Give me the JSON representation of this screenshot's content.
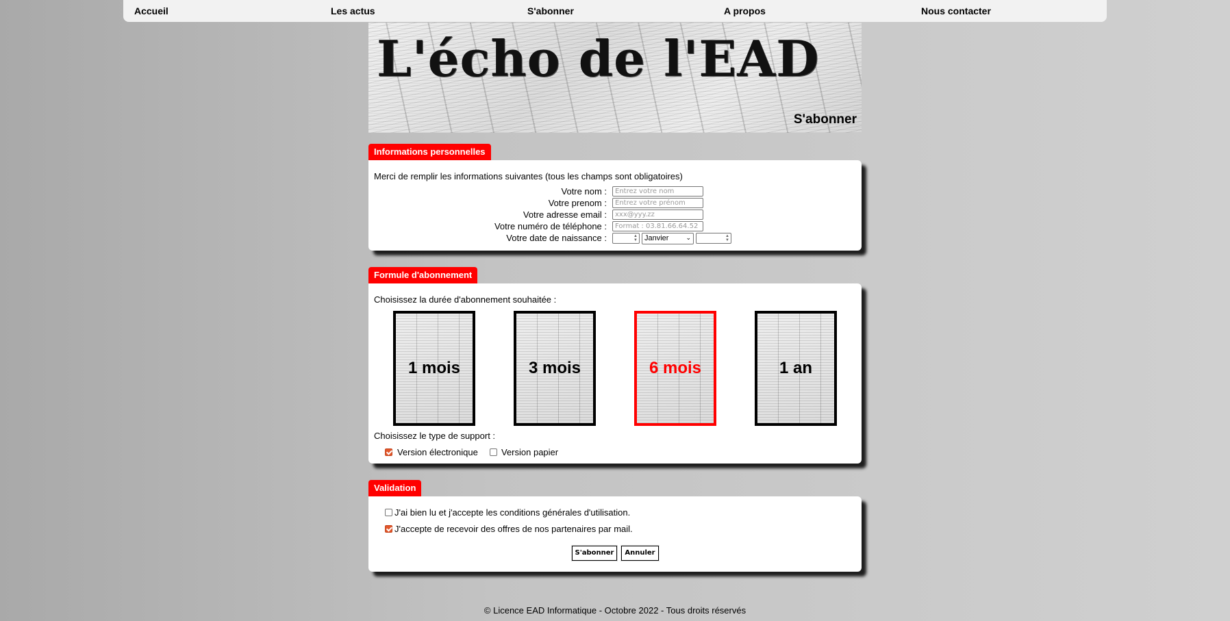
{
  "nav": {
    "items": [
      "Accueil",
      "Les actus",
      "S'abonner",
      "A propos",
      "Nous contacter"
    ]
  },
  "banner": {
    "title": "L'écho de l'EAD",
    "subtitle": "S'abonner"
  },
  "personal": {
    "tab": "Informations personnelles",
    "intro": "Merci de remplir les informations suivantes (tous les champs sont obligatoires)",
    "fields": [
      {
        "label": "Votre nom :",
        "placeholder": "Entrez votre nom"
      },
      {
        "label": "Votre prenom :",
        "placeholder": "Entrez votre prénom"
      },
      {
        "label": "Votre adresse email :",
        "placeholder": "xxx@yyy.zz"
      },
      {
        "label": "Votre numéro de téléphone :",
        "placeholder": "Format : 03.81.66.64.52"
      }
    ],
    "birthdate": {
      "label": "Votre date de naissance :",
      "day": "",
      "month": "Janvier",
      "year": ""
    }
  },
  "subscription": {
    "tab": "Formule d'abonnement",
    "duration_prompt": "Choisissez la durée d'abonnement souhaitée :",
    "durations": [
      {
        "label": "1 mois",
        "selected": false
      },
      {
        "label": "3 mois",
        "selected": false
      },
      {
        "label": "6 mois",
        "selected": true
      },
      {
        "label": "1 an",
        "selected": false
      }
    ],
    "support_prompt": "Choisissez le type de support :",
    "supports": [
      {
        "label": "Version électronique",
        "checked": true
      },
      {
        "label": "Version papier",
        "checked": false
      }
    ]
  },
  "validation": {
    "tab": "Validation",
    "checks": [
      {
        "label": "J'ai bien lu et j'accepte les conditions générales d'utilisation.",
        "checked": false
      },
      {
        "label": "J'accepte de recevoir des offres de nos partenaires par mail.",
        "checked": true
      }
    ],
    "submit_label": "S'abonner",
    "cancel_label": "Annuler"
  },
  "footer": {
    "text": "© Licence EAD Informatique - Octobre 2022 - Tous droits réservés"
  },
  "colors": {
    "accent": "#ff0000",
    "checkbox": "#e2572b"
  }
}
